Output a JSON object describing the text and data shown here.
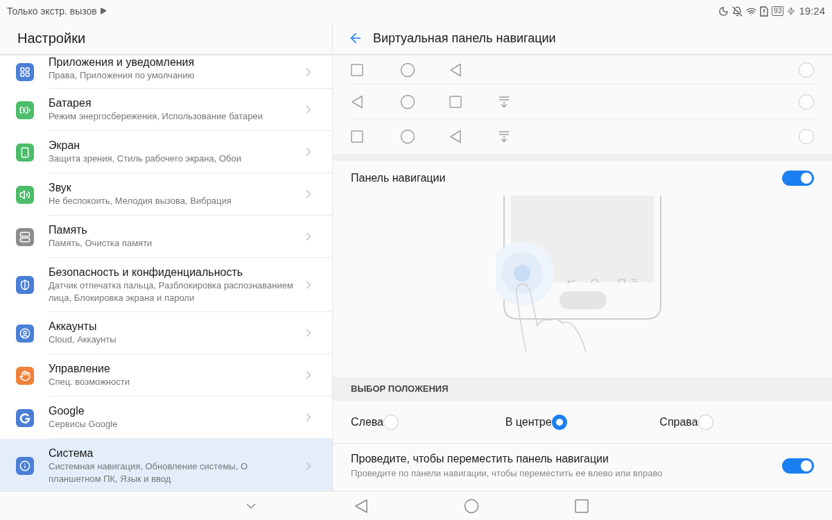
{
  "status_bar": {
    "carrier": "Только экстр. вызов",
    "battery": "93",
    "time": "19:24"
  },
  "sidebar": {
    "title": "Настройки",
    "items": [
      {
        "title": "Приложения и уведомления",
        "subtitle": "Права, Приложения по умолчанию",
        "color": "#4a7fd6",
        "selected": false
      },
      {
        "title": "Батарея",
        "subtitle": "Режим энергосбережения, Использование батареи",
        "color": "#4cbd6a",
        "selected": false
      },
      {
        "title": "Экран",
        "subtitle": "Защита зрения, Стиль рабочего экрана, Обои",
        "color": "#4cbd6a",
        "selected": false
      },
      {
        "title": "Звук",
        "subtitle": "Не беспокоить, Мелодия вызова, Вибрация",
        "color": "#4cbd6a",
        "selected": false
      },
      {
        "title": "Память",
        "subtitle": "Память, Очистка памяти",
        "color": "#8c8c8c",
        "selected": false
      },
      {
        "title": "Безопасность и конфиденциальность",
        "subtitle": "Датчик отпечатка пальца, Разблокировка распознаванием лица, Блокировка экрана и пароли",
        "color": "#4a7fd6",
        "selected": false
      },
      {
        "title": "Аккаунты",
        "subtitle": "Cloud, Аккаунты",
        "color": "#4a7fd6",
        "selected": false
      },
      {
        "title": "Управление",
        "subtitle": "Спец. возможности",
        "color": "#f0813a",
        "selected": false
      },
      {
        "title": "Google",
        "subtitle": "Сервисы Google",
        "color": "#4a7fd6",
        "selected": false
      },
      {
        "title": "Система",
        "subtitle": "Системная навигация, Обновление системы, О планшетном ПК, Язык и ввод",
        "color": "#4a7fd6",
        "selected": true
      }
    ]
  },
  "detail": {
    "title": "Виртуальная панель навигации",
    "layouts": [
      {
        "keys": [
          {
            "kind": "square"
          },
          {
            "kind": "circle"
          },
          {
            "kind": "back"
          }
        ],
        "selected": false
      },
      {
        "keys": [
          {
            "kind": "back"
          },
          {
            "kind": "circle"
          },
          {
            "kind": "square"
          },
          {
            "kind": "pulldown"
          }
        ],
        "selected": false
      },
      {
        "keys": [
          {
            "kind": "square"
          },
          {
            "kind": "circle"
          },
          {
            "kind": "back"
          },
          {
            "kind": "pulldown"
          }
        ],
        "selected": false
      }
    ],
    "nav_panel": {
      "label": "Панель навигации",
      "on": true
    },
    "position_section": {
      "header": "ВЫБОР ПОЛОЖЕНИЯ",
      "options": [
        {
          "label": "Слева",
          "selected": false
        },
        {
          "label": "В центре",
          "selected": true
        },
        {
          "label": "Справа",
          "selected": false
        }
      ]
    },
    "swipe": {
      "label": "Проведите, чтобы переместить панель навигации",
      "description": "Проведите по панели навигации, чтобы переместить ее влево или вправо",
      "on": true
    }
  },
  "nav_bar": [
    {
      "kind": "hide"
    },
    {
      "kind": "back"
    },
    {
      "kind": "home"
    },
    {
      "kind": "recent"
    }
  ]
}
